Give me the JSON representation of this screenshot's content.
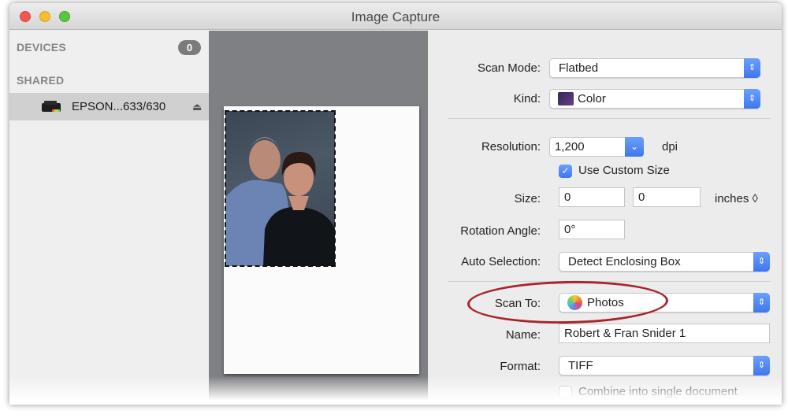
{
  "window": {
    "title": "Image Capture"
  },
  "sidebar": {
    "devices_header": "DEVICES",
    "devices_count": "0",
    "shared_header": "SHARED",
    "items": [
      {
        "label": "EPSON...633/630",
        "icon": "printer-icon",
        "action_icon": "eject-icon",
        "selected": true
      }
    ]
  },
  "preview": {
    "selection": "dashed-rectangle around photo"
  },
  "settings": {
    "scan_mode": {
      "label": "Scan Mode:",
      "value": "Flatbed"
    },
    "kind": {
      "label": "Kind:",
      "value": "Color",
      "icon": "color-kind-icon"
    },
    "resolution": {
      "label": "Resolution:",
      "value": "1,200",
      "unit": "dpi"
    },
    "use_custom_size": {
      "label": "Use Custom Size",
      "checked": true
    },
    "size": {
      "label": "Size:",
      "width": "0",
      "height": "0",
      "unit": "inches ◊"
    },
    "rotation": {
      "label": "Rotation Angle:",
      "value": "0°"
    },
    "auto_selection": {
      "label": "Auto Selection:",
      "value": "Detect Enclosing Box"
    },
    "scan_to": {
      "label": "Scan To:",
      "value": "Photos",
      "icon": "photos-app-icon",
      "highlighted": true,
      "highlight_color": "#a8252c"
    },
    "name": {
      "label": "Name:",
      "value": "Robert & Fran Snider 1"
    },
    "format": {
      "label": "Format:",
      "value": "TIFF"
    },
    "combine": {
      "label": "Combine into single document",
      "checked": false
    }
  },
  "icons": {
    "popup_arrows": "⌃⌄",
    "combo_arrow": "⌄",
    "check": "✓",
    "eject": "⏏",
    "updown": "⇕"
  },
  "colors": {
    "accent": "#3f76ee",
    "highlight_ring": "#a8252c",
    "preview_bg": "#7f8084"
  }
}
